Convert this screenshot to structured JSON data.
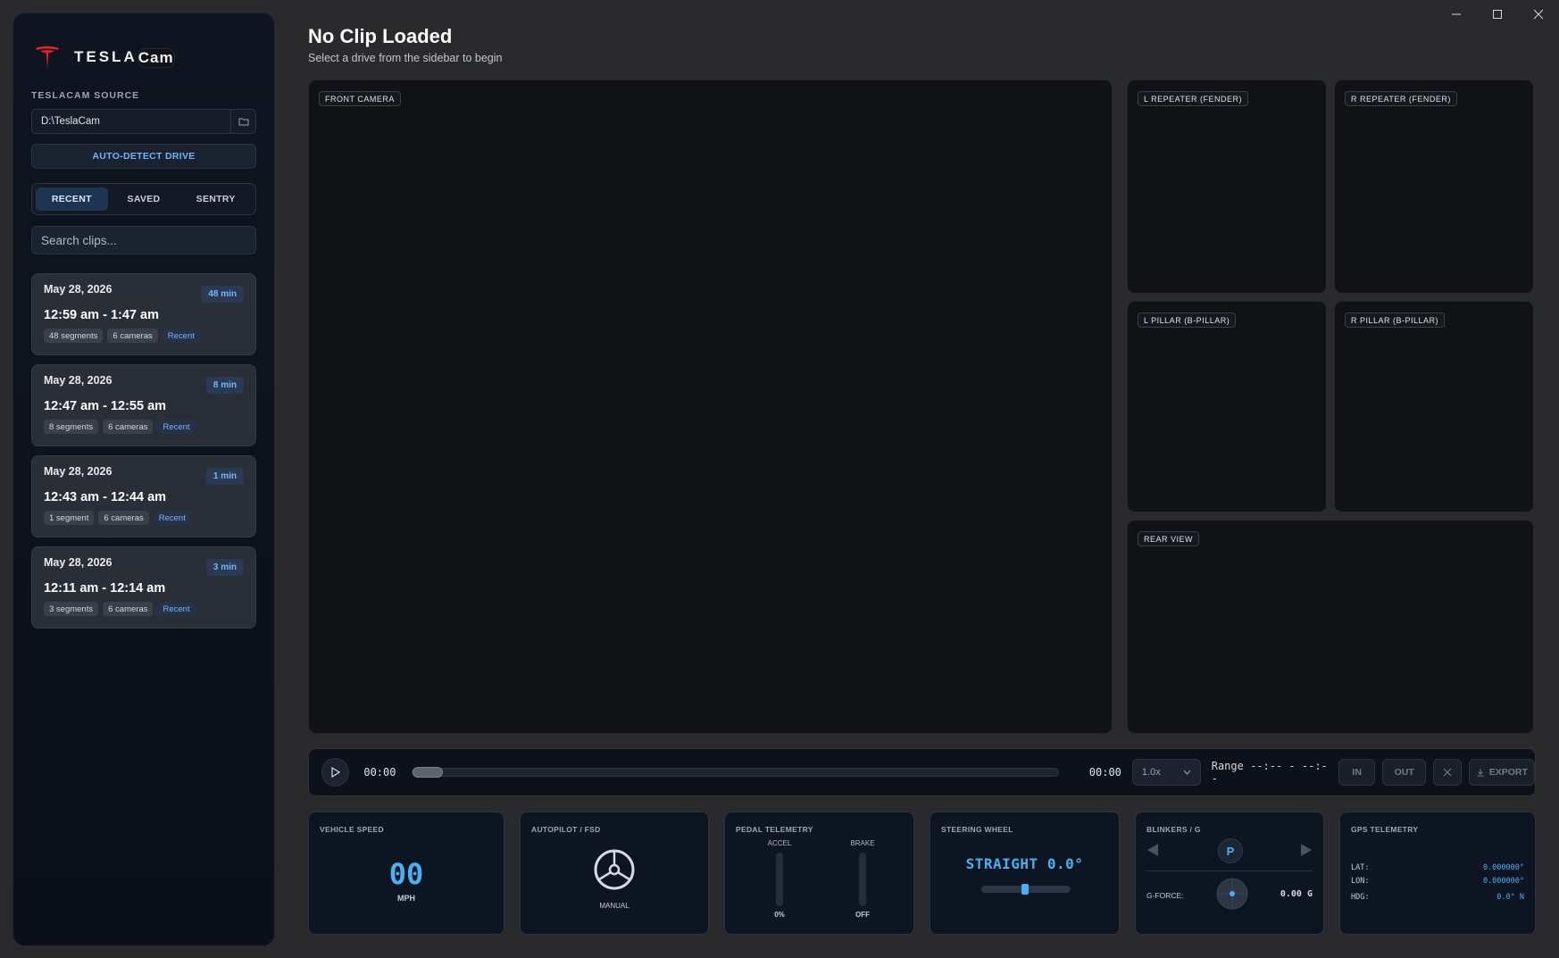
{
  "window": {
    "minimize_glyph": "—",
    "maximize_glyph": "☐",
    "close_glyph": "✕"
  },
  "sidebar": {
    "brand_tesla": "TESLA",
    "brand_cam": "Cam",
    "source_label": "TESLACAM SOURCE",
    "source_path": "D:\\TeslaCam",
    "auto_detect": "AUTO-DETECT DRIVE",
    "tabs": [
      "RECENT",
      "SAVED",
      "SENTRY"
    ],
    "search_placeholder": "Search clips...",
    "clips": [
      {
        "date": "May 28, 2026",
        "duration": "48 min",
        "time": "12:59 am - 1:47 am",
        "segments": "48 segments",
        "cameras": "6 cameras",
        "tag": "Recent"
      },
      {
        "date": "May 28, 2026",
        "duration": "8 min",
        "time": "12:47 am - 12:55 am",
        "segments": "8 segments",
        "cameras": "6 cameras",
        "tag": "Recent"
      },
      {
        "date": "May 28, 2026",
        "duration": "1 min",
        "time": "12:43 am - 12:44 am",
        "segments": "1 segment",
        "cameras": "6 cameras",
        "tag": "Recent"
      },
      {
        "date": "May 28, 2026",
        "duration": "3 min",
        "time": "12:11 am - 12:14 am",
        "segments": "3 segments",
        "cameras": "6 cameras",
        "tag": "Recent"
      }
    ]
  },
  "header": {
    "title": "No Clip Loaded",
    "subtitle": "Select a drive from the sidebar to begin"
  },
  "cameras": {
    "front": "FRONT CAMERA",
    "left_repeater": "L REPEATER (FENDER)",
    "right_repeater": "R REPEATER (FENDER)",
    "left_pillar": "L PILLAR (B-PILLAR)",
    "right_pillar": "R PILLAR (B-PILLAR)",
    "rear": "REAR VIEW"
  },
  "playback": {
    "current_time": "00:00",
    "end_time": "00:00",
    "progress": 0,
    "speed": "1.0x",
    "range_label": "Range",
    "range_value": "--:-- - --:--",
    "in_label": "IN",
    "out_label": "OUT",
    "export_label": "EXPORT"
  },
  "telemetry": {
    "speed": {
      "title": "VEHICLE SPEED",
      "value": "00",
      "unit": "MPH"
    },
    "autopilot": {
      "title": "AUTOPILOT / FSD",
      "state": "MANUAL"
    },
    "pedals": {
      "title": "PEDAL TELEMETRY",
      "accel_label": "ACCEL",
      "accel_value": "0%",
      "brake_label": "BRAKE",
      "brake_value": "OFF"
    },
    "steering": {
      "title": "STEERING WHEEL",
      "value": "STRAIGHT 0.0°"
    },
    "blinkers": {
      "title": "BLINKERS / G",
      "gear": "P",
      "gforce_label": "G-FORCE:",
      "gforce_value": "0.00 G"
    },
    "gps": {
      "title": "GPS TELEMETRY",
      "lat_label": "LAT:",
      "lat_value": "0.000000°",
      "lon_label": "LON:",
      "lon_value": "0.000000°",
      "hdg_label": "HDG:",
      "hdg_value": "0.0° N"
    }
  },
  "colors": {
    "accent": "#4ab0f4",
    "link": "#74b5ff",
    "tesla_red": "#e82127"
  }
}
